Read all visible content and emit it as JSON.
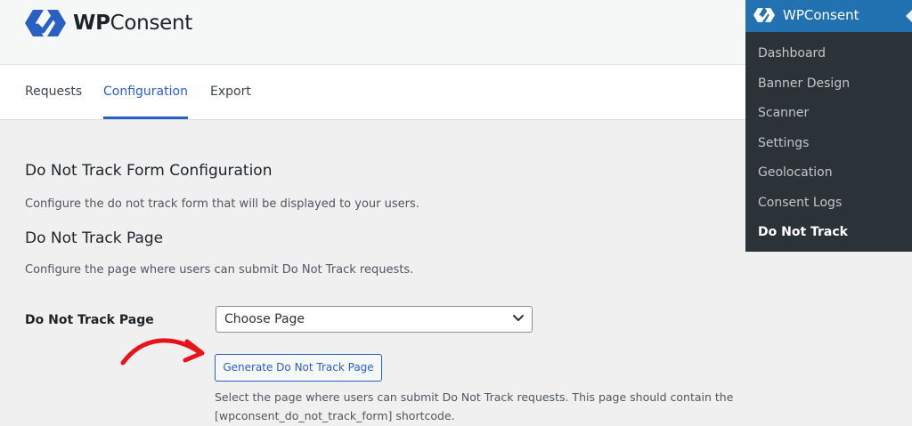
{
  "brand": {
    "name_bold": "WP",
    "name_rest": "Consent"
  },
  "tabs": [
    {
      "label": "Requests",
      "active": false
    },
    {
      "label": "Configuration",
      "active": true
    },
    {
      "label": "Export",
      "active": false
    }
  ],
  "form_config": {
    "title": "Do Not Track Form Configuration",
    "description": "Configure the do not track form that will be displayed to your users."
  },
  "page_section": {
    "title": "Do Not Track Page",
    "description": "Configure the page where users can submit Do Not Track requests.",
    "field_label": "Do Not Track Page",
    "select_value": "Choose Page",
    "generate_button": "Generate Do Not Track Page",
    "help_text": "Select the page where users can submit Do Not Track requests. This page should contain the [wpconsent_do_not_track_form] shortcode."
  },
  "admin_menu": {
    "title": "WPConsent",
    "items": [
      {
        "label": "Dashboard",
        "current": false
      },
      {
        "label": "Banner Design",
        "current": false
      },
      {
        "label": "Scanner",
        "current": false
      },
      {
        "label": "Settings",
        "current": false
      },
      {
        "label": "Geolocation",
        "current": false
      },
      {
        "label": "Consent Logs",
        "current": false
      },
      {
        "label": "Do Not Track",
        "current": true
      }
    ]
  },
  "colors": {
    "accent": "#2a5fc4",
    "admin_bg": "#2c3338",
    "admin_head": "#2271b1",
    "annotation_arrow": "#e8141b"
  },
  "icons": {
    "logo": "wpconsent-logo-icon",
    "select": "chevron-down-icon",
    "annotation": "curved-arrow-icon"
  }
}
